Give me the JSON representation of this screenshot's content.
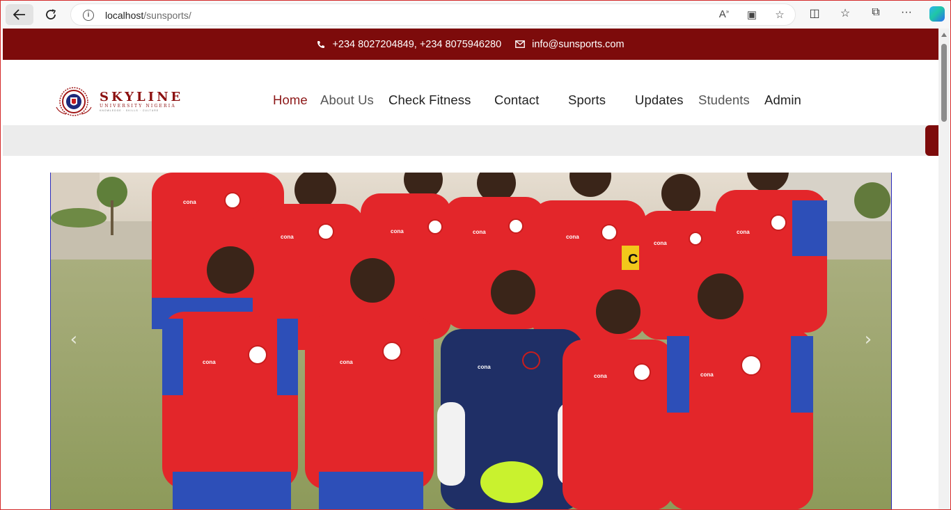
{
  "browser": {
    "url_host": "localhost",
    "url_path": "/sunsports/",
    "icons": [
      "back-arrow-icon",
      "reload-icon",
      "info-icon",
      "read-aloud-icon",
      "immersive-reader-icon",
      "favorite-star-icon",
      "split-screen-icon",
      "favorites-icon",
      "collections-icon",
      "more-icon",
      "copilot-icon"
    ]
  },
  "topbar": {
    "phone": "+234 8027204849, +234 8075946280",
    "email": "info@sunsports.com",
    "bg_color": "#7d0b0b"
  },
  "logo": {
    "title": "SKYLINE",
    "subtitle": "UNIVERSITY NIGERIA",
    "tagline": "KNOWLEDGE · SKILLS · CULTURE"
  },
  "nav": {
    "items": [
      {
        "label": "Home"
      },
      {
        "label": "About Us"
      },
      {
        "label": "Check Fitness"
      },
      {
        "label": "Contact"
      },
      {
        "label": "Sports"
      },
      {
        "label": "Updates"
      },
      {
        "label": "Students"
      },
      {
        "label": "Admin"
      }
    ],
    "active": "Home",
    "active_color": "#8c1717"
  },
  "carousel": {
    "prev_symbol": "‹",
    "next_symbol": "›",
    "kit_label": "cona",
    "captain_armband": "C"
  }
}
